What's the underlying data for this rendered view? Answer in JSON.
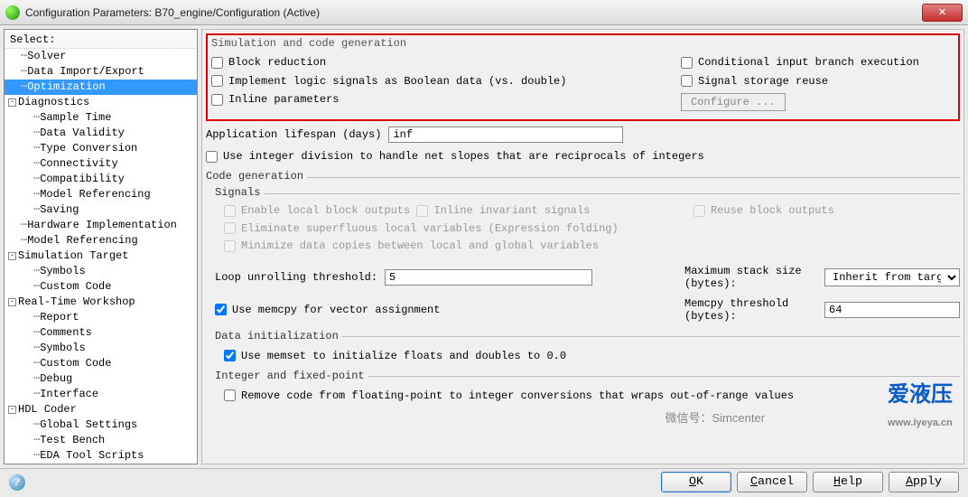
{
  "window": {
    "title": "Configuration Parameters: B70_engine/Configuration (Active)"
  },
  "tree": {
    "select_label": "Select:",
    "items": [
      {
        "label": "Solver",
        "prefix": "⋯",
        "indent": 1
      },
      {
        "label": "Data Import/Export",
        "prefix": "⋯",
        "indent": 1
      },
      {
        "label": "Optimization",
        "prefix": "⋯",
        "indent": 1,
        "selected": true
      },
      {
        "label": "Diagnostics",
        "prefix": "⊟",
        "indent": 0
      },
      {
        "label": "Sample Time",
        "prefix": "⋯",
        "indent": 2
      },
      {
        "label": "Data Validity",
        "prefix": "⋯",
        "indent": 2
      },
      {
        "label": "Type Conversion",
        "prefix": "⋯",
        "indent": 2
      },
      {
        "label": "Connectivity",
        "prefix": "⋯",
        "indent": 2
      },
      {
        "label": "Compatibility",
        "prefix": "⋯",
        "indent": 2
      },
      {
        "label": "Model Referencing",
        "prefix": "⋯",
        "indent": 2
      },
      {
        "label": "Saving",
        "prefix": "⋯",
        "indent": 2
      },
      {
        "label": "Hardware Implementation",
        "prefix": "⋯",
        "indent": 1
      },
      {
        "label": "Model Referencing",
        "prefix": "⋯",
        "indent": 1
      },
      {
        "label": "Simulation Target",
        "prefix": "⊟",
        "indent": 0
      },
      {
        "label": "Symbols",
        "prefix": "⋯",
        "indent": 2
      },
      {
        "label": "Custom Code",
        "prefix": "⋯",
        "indent": 2
      },
      {
        "label": "Real-Time Workshop",
        "prefix": "⊟",
        "indent": 0
      },
      {
        "label": "Report",
        "prefix": "⋯",
        "indent": 2
      },
      {
        "label": "Comments",
        "prefix": "⋯",
        "indent": 2
      },
      {
        "label": "Symbols",
        "prefix": "⋯",
        "indent": 2
      },
      {
        "label": "Custom Code",
        "prefix": "⋯",
        "indent": 2
      },
      {
        "label": "Debug",
        "prefix": "⋯",
        "indent": 2
      },
      {
        "label": "Interface",
        "prefix": "⋯",
        "indent": 2
      },
      {
        "label": "HDL Coder",
        "prefix": "⊟",
        "indent": 0
      },
      {
        "label": "Global Settings",
        "prefix": "⋯",
        "indent": 2
      },
      {
        "label": "Test Bench",
        "prefix": "⋯",
        "indent": 2
      },
      {
        "label": "EDA Tool Scripts",
        "prefix": "⋯",
        "indent": 2
      }
    ]
  },
  "sim": {
    "title": "Simulation and code generation",
    "block_reduction": "Block reduction",
    "conditional_branch": "Conditional input branch execution",
    "implement_logic": "Implement logic signals as Boolean data (vs. double)",
    "signal_storage": "Signal storage reuse",
    "inline_params": "Inline parameters",
    "configure_btn": "Configure ..."
  },
  "lifespan": {
    "label": "Application lifespan (days)",
    "value": "inf"
  },
  "integer_div": "Use integer division to handle net slopes that are reciprocals of integers",
  "codegen": {
    "title": "Code generation",
    "signals": {
      "title": "Signals",
      "enable_local": "Enable local block outputs",
      "reuse": "Reuse block outputs",
      "inline_invariant": "Inline invariant signals",
      "eliminate": "Eliminate superfluous local variables (Expression folding)",
      "minimize": "Minimize data copies between local and global variables"
    },
    "loop_label": "Loop unrolling threshold:",
    "loop_value": "5",
    "max_stack_label": "Maximum stack size (bytes):",
    "max_stack_value": "Inherit from target",
    "memcpy_cb": "Use memcpy for vector assignment",
    "memcpy_thresh_label": "Memcpy threshold (bytes):",
    "memcpy_thresh_value": "64",
    "datainit": {
      "title": "Data initialization",
      "memset": "Use memset to initialize floats and doubles to 0.0"
    },
    "intfixed": {
      "title": "Integer and fixed-point",
      "remove": "Remove code from floating-point to integer conversions that wraps out-of-range values"
    }
  },
  "footer": {
    "ok": "OK",
    "cancel": "Cancel",
    "help": "Help",
    "apply": "Apply"
  }
}
